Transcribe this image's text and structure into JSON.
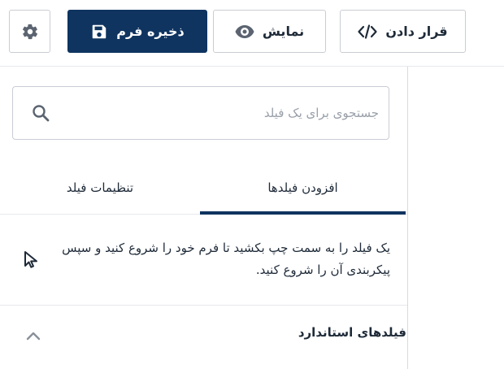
{
  "toolbar": {
    "embed_label": "قرار دادن",
    "preview_label": "نمایش",
    "save_label": "ذخیره فرم"
  },
  "search": {
    "placeholder": "جستجوی برای یک فیلد",
    "value": ""
  },
  "tabs": [
    {
      "label": "افزودن فیلدها",
      "active": true
    },
    {
      "label": "تنظیمات فیلد",
      "active": false
    }
  ],
  "hint": {
    "text": "یک فیلد را به سمت چپ بکشید تا فرم خود را شروع کنید و سپس پیکربندی آن را شروع کنید."
  },
  "sections": [
    {
      "title": "فیلدهای استاندارد",
      "expanded": true
    }
  ],
  "icons": {
    "settings": "gear-icon",
    "save": "floppy-disk-icon",
    "preview": "eye-icon",
    "embed": "code-icon",
    "search": "search-icon",
    "pointer": "mouse-pointer-icon",
    "collapse": "chevron-up-icon"
  },
  "colors": {
    "primary": "#0f3460",
    "text": "#1e2a38",
    "icon_gray": "#5b6470",
    "border": "#c9cdd4"
  }
}
